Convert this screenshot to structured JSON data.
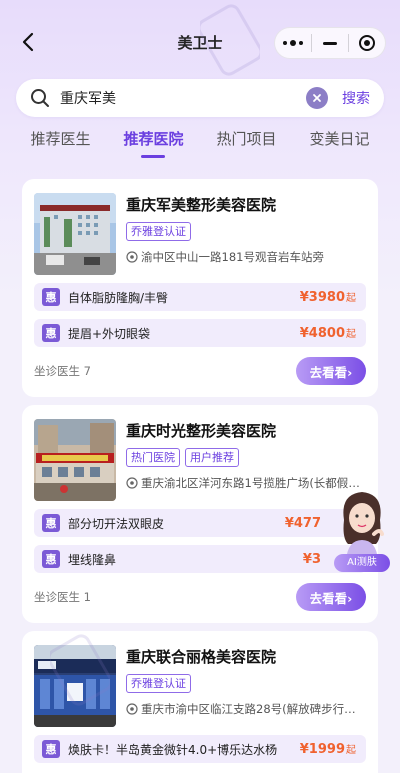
{
  "nav": {
    "title": "美卫士"
  },
  "search": {
    "value": "重庆军美",
    "button": "搜索"
  },
  "tabs": [
    {
      "label": "推荐医生",
      "active": false
    },
    {
      "label": "推荐医院",
      "active": true
    },
    {
      "label": "热门项目",
      "active": false
    },
    {
      "label": "变美日记",
      "active": false
    }
  ],
  "hospitals": [
    {
      "name": "重庆军美整形美容医院",
      "tags": [
        "乔雅登认证"
      ],
      "address": "渝中区中山一路181号观音岩车站旁",
      "items": [
        {
          "badge": "惠",
          "name": "自体脂肪隆胸/丰臀",
          "price": "¥3980",
          "unit": "起"
        },
        {
          "badge": "惠",
          "name": "提眉+外切眼袋",
          "price": "¥4800",
          "unit": "起"
        }
      ],
      "doctors": "坐诊医生 7",
      "button": "去看看›"
    },
    {
      "name": "重庆时光整形美容医院",
      "tags": [
        "热门医院",
        "用户推荐"
      ],
      "address": "重庆渝北区洋河东路1号揽胜广场(长都假日...",
      "items": [
        {
          "badge": "惠",
          "name": "部分切开法双眼皮",
          "price": "¥477",
          "unit": ""
        },
        {
          "badge": "惠",
          "name": "埋线隆鼻",
          "price": "¥3",
          "unit": ""
        }
      ],
      "doctors": "坐诊医生 1",
      "button": "去看看›"
    },
    {
      "name": "重庆联合丽格美容医院",
      "tags": [
        "乔雅登认证"
      ],
      "address": "重庆市渝中区临江支路28号(解放碑步行街王...",
      "items": [
        {
          "badge": "惠",
          "name": "焕肤卡！半岛黄金微针4.0+博乐达水杨",
          "price": "¥1999",
          "unit": "起"
        }
      ],
      "doctors": "",
      "button": ""
    }
  ],
  "ai": {
    "label": "AI测肤"
  },
  "icons": {
    "back": "back-arrow-icon",
    "search": "search-icon",
    "clear": "clear-icon",
    "more": "more-dots-icon",
    "minimize": "minimize-icon",
    "close": "target-close-icon",
    "location": "location-pin-icon"
  },
  "colors": {
    "accent": "#6b3fe0",
    "price": "#f0622f",
    "badge": "#7b5ad6"
  }
}
